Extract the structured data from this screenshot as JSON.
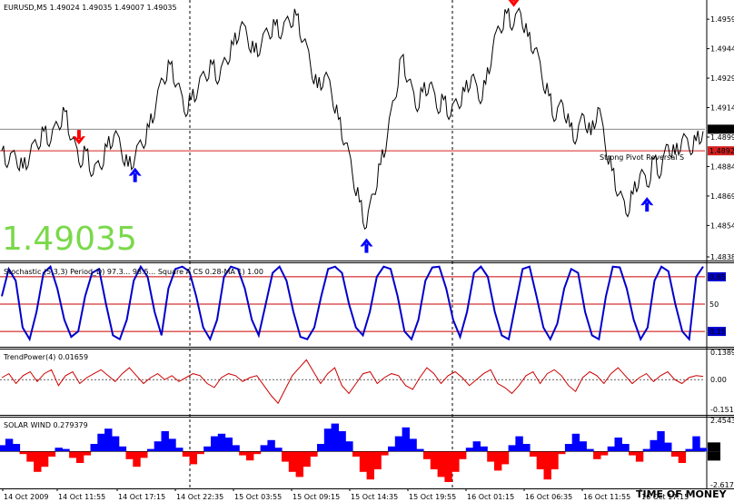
{
  "header": {
    "symbol_line": "EURUSD,M5  1.49024 1.49035 1.49007 1.49035",
    "big_price": "1.49035",
    "watermark": "TIME OF MONEY"
  },
  "colors": {
    "background": "#ffffff",
    "price_line": "#000000",
    "stoch_line": "#0000cc",
    "trend_line": "#cc0000",
    "solar_pos": "#0000ff",
    "solar_neg": "#ff0000",
    "big_price": "#7ad94a",
    "arrow_up": "#0000ff",
    "arrow_down": "#ff0000"
  },
  "chart_data": [
    {
      "type": "line",
      "panel": "price",
      "title": "EURUSD,M5",
      "y_ticks": [
        "1.4959",
        "1.4944",
        "1.4929",
        "1.4914",
        "1.4899",
        "1.4884",
        "1.4869",
        "1.4854",
        "1.4838"
      ],
      "ylim": [
        1.4838,
        1.4966
      ],
      "hlines": [
        {
          "label": "1.4903",
          "value": 1.4903
        },
        {
          "label": "1.4892",
          "value": 1.4892,
          "note": "Strong  Pivot  Reversal  S"
        }
      ],
      "current_price_label": "1.4903",
      "pivot_label": "1.4892",
      "pivot_note": "Strong  Pivot  Reversal  S",
      "series": [
        {
          "values": [
            1.4892,
            1.4886,
            1.4889,
            1.4883,
            1.489,
            1.4895,
            1.4902,
            1.4897,
            1.4905,
            1.4912,
            1.4898,
            1.4886,
            1.4892,
            1.488,
            1.4884,
            1.4894,
            1.49,
            1.4893,
            1.4884,
            1.4889,
            1.4895,
            1.4904,
            1.4916,
            1.4928,
            1.4936,
            1.4926,
            1.4912,
            1.4918,
            1.4924,
            1.493,
            1.4936,
            1.4928,
            1.4938,
            1.4946,
            1.4955,
            1.495,
            1.4942,
            1.4946,
            1.4952,
            1.4956,
            1.4952,
            1.4958,
            1.4961,
            1.4948,
            1.4936,
            1.4924,
            1.493,
            1.4922,
            1.4908,
            1.4896,
            1.488,
            1.4866,
            1.4853,
            1.487,
            1.4885,
            1.49,
            1.4918,
            1.494,
            1.4928,
            1.4914,
            1.4922,
            1.4926,
            1.4914,
            1.4918,
            1.491,
            1.4916,
            1.4922,
            1.493,
            1.4918,
            1.4926,
            1.4944,
            1.4954,
            1.4962,
            1.4956,
            1.4962,
            1.495,
            1.4944,
            1.493,
            1.492,
            1.4908,
            1.4916,
            1.4904,
            1.4898,
            1.491,
            1.49,
            1.4914,
            1.4896,
            1.4882,
            1.487,
            1.486,
            1.487,
            1.488,
            1.4874,
            1.4888,
            1.488,
            1.4895,
            1.489,
            1.4898,
            1.4893,
            1.4897,
            1.4902
          ]
        }
      ],
      "markers": [
        {
          "type": "arrow-down",
          "index": 11
        },
        {
          "type": "arrow-up",
          "index": 19
        },
        {
          "type": "arrow-down",
          "index": 42
        },
        {
          "type": "arrow-up",
          "index": 52
        },
        {
          "type": "arrow-down",
          "index": 73
        },
        {
          "type": "arrow-up",
          "index": 92
        }
      ]
    },
    {
      "type": "line",
      "panel": "stochastic",
      "label": "Stochastic (5,3,3) Period_D) 97.3... 98.5... Square A CS 0.28-MA 1) 1.00",
      "levels": [
        {
          "label": "0.85",
          "value": 85
        },
        {
          "label": "50",
          "value": 50
        },
        {
          "label": "0.15",
          "value": 15
        }
      ],
      "ylim": [
        0,
        100
      ],
      "series": [
        {
          "values": [
            60,
            95,
            80,
            20,
            5,
            40,
            90,
            98,
            70,
            30,
            8,
            15,
            60,
            90,
            95,
            50,
            10,
            5,
            30,
            80,
            98,
            85,
            40,
            10,
            70,
            95,
            98,
            92,
            60,
            20,
            5,
            30,
            85,
            98,
            95,
            70,
            30,
            10,
            50,
            90,
            98,
            80,
            40,
            8,
            5,
            20,
            60,
            95,
            98,
            90,
            50,
            20,
            10,
            40,
            85,
            98,
            95,
            60,
            15,
            5,
            30,
            80,
            97,
            98,
            70,
            30,
            8,
            40,
            90,
            98,
            85,
            40,
            10,
            5,
            50,
            95,
            98,
            60,
            20,
            5,
            25,
            70,
            95,
            90,
            40,
            10,
            5,
            60,
            98,
            97,
            70,
            30,
            5,
            20,
            80,
            98,
            92,
            50,
            15,
            5,
            85,
            98
          ]
        }
      ]
    },
    {
      "type": "line",
      "panel": "trendpower",
      "label": "TrendPower(4) 0.01659",
      "y_ticks": [
        "0.1389",
        "0.00",
        "-0.1512"
      ],
      "ylim": [
        -0.1512,
        0.1389
      ],
      "series": [
        {
          "values": [
            0.01,
            0.03,
            -0.02,
            0.02,
            0.04,
            -0.01,
            0.03,
            0.05,
            -0.03,
            0.02,
            0.04,
            -0.02,
            0.01,
            0.03,
            0.05,
            0.02,
            -0.01,
            0.03,
            0.06,
            0.02,
            -0.02,
            0.01,
            0.03,
            0.0,
            0.02,
            -0.01,
            0.01,
            0.03,
            0.02,
            -0.02,
            -0.04,
            0.01,
            0.03,
            0.02,
            -0.01,
            0.01,
            0.02,
            -0.03,
            -0.08,
            -0.12,
            -0.05,
            0.02,
            0.06,
            0.1,
            0.04,
            -0.02,
            0.03,
            0.06,
            -0.03,
            -0.07,
            -0.02,
            0.03,
            0.04,
            -0.02,
            0.01,
            0.03,
            0.02,
            -0.03,
            -0.05,
            0.01,
            0.06,
            0.03,
            -0.02,
            0.02,
            0.04,
            0.01,
            -0.03,
            0.0,
            0.03,
            0.05,
            -0.02,
            -0.04,
            -0.07,
            -0.03,
            0.02,
            0.04,
            -0.02,
            0.03,
            0.05,
            0.02,
            -0.03,
            -0.06,
            0.01,
            0.04,
            0.02,
            -0.02,
            0.03,
            0.06,
            0.02,
            -0.02,
            0.01,
            0.03,
            -0.01,
            0.02,
            0.04,
            0.0,
            -0.02,
            0.01,
            0.02,
            0.0166
          ]
        }
      ]
    },
    {
      "type": "area",
      "panel": "solar_wind",
      "label": "SOLAR WIND 0.279379",
      "y_ticks": [
        "2.4543",
        "-2.6172"
      ],
      "right_labels": [
        "0.3",
        "0.3"
      ],
      "ylim": [
        -2.6172,
        2.4543
      ],
      "series": [
        {
          "values": [
            0.5,
            1.0,
            0.6,
            -0.2,
            -0.8,
            -1.6,
            -1.2,
            -0.4,
            0.3,
            0.2,
            -0.5,
            -0.9,
            -0.3,
            0.6,
            1.4,
            1.8,
            1.2,
            0.4,
            -0.6,
            -1.2,
            -0.5,
            0.2,
            0.8,
            1.6,
            1.0,
            0.3,
            -0.4,
            -1.0,
            -0.2,
            0.4,
            1.2,
            1.4,
            1.1,
            0.5,
            -0.3,
            -0.7,
            -0.2,
            0.5,
            0.9,
            0.3,
            -0.8,
            -1.6,
            -2.0,
            -1.2,
            -0.4,
            0.6,
            1.8,
            2.2,
            1.6,
            0.8,
            -0.4,
            -1.6,
            -2.2,
            -1.4,
            -0.3,
            0.4,
            1.2,
            1.9,
            1.0,
            0.2,
            -0.6,
            -1.4,
            -2.0,
            -2.4,
            -1.6,
            -0.6,
            0.3,
            0.8,
            0.4,
            -0.8,
            -1.5,
            -1.0,
            0.5,
            1.2,
            0.6,
            -0.4,
            -1.4,
            -2.2,
            -1.4,
            -0.2,
            0.6,
            1.4,
            0.8,
            0.2,
            -0.6,
            -0.3,
            0.4,
            1.1,
            0.6,
            -0.3,
            -0.8,
            0.2,
            0.9,
            1.6,
            0.7,
            -0.4,
            -0.9,
            0.2,
            1.2,
            0.28
          ]
        }
      ]
    }
  ],
  "x_axis": {
    "ticks": [
      "14 Oct 2009",
      "14 Oct 11:55",
      "14 Oct 17:15",
      "14 Oct 22:35",
      "15 Oct 03:55",
      "15 Oct 09:15",
      "15 Oct 14:35",
      "15 Oct 19:55",
      "16 Oct 01:15",
      "16 Oct 06:35",
      "16 Oct 11:55",
      "16 Oct 17:15"
    ]
  }
}
